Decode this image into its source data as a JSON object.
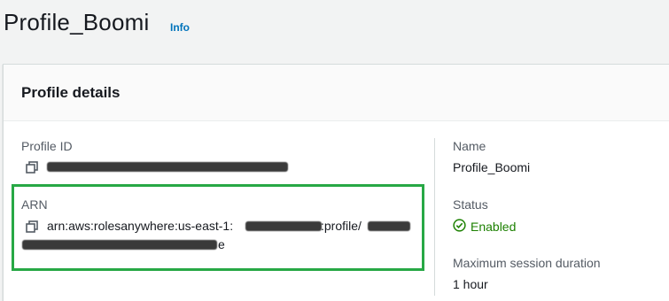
{
  "page": {
    "title": "Profile_Boomi",
    "info_link": "Info"
  },
  "panel": {
    "title": "Profile details",
    "profile_id": {
      "label": "Profile ID"
    },
    "arn": {
      "label": "ARN",
      "prefix": "arn:aws:rolesanywhere:us-east-1:",
      "middle": ":profile/",
      "suffix": "e"
    },
    "name": {
      "label": "Name",
      "value": "Profile_Boomi"
    },
    "status": {
      "label": "Status",
      "value": "Enabled",
      "icon": "check-circle-icon",
      "color": "#1d8102"
    },
    "max_session": {
      "label": "Maximum session duration",
      "value": "1 hour"
    }
  },
  "colors": {
    "highlight_border": "#27a845",
    "link": "#0073bb"
  }
}
